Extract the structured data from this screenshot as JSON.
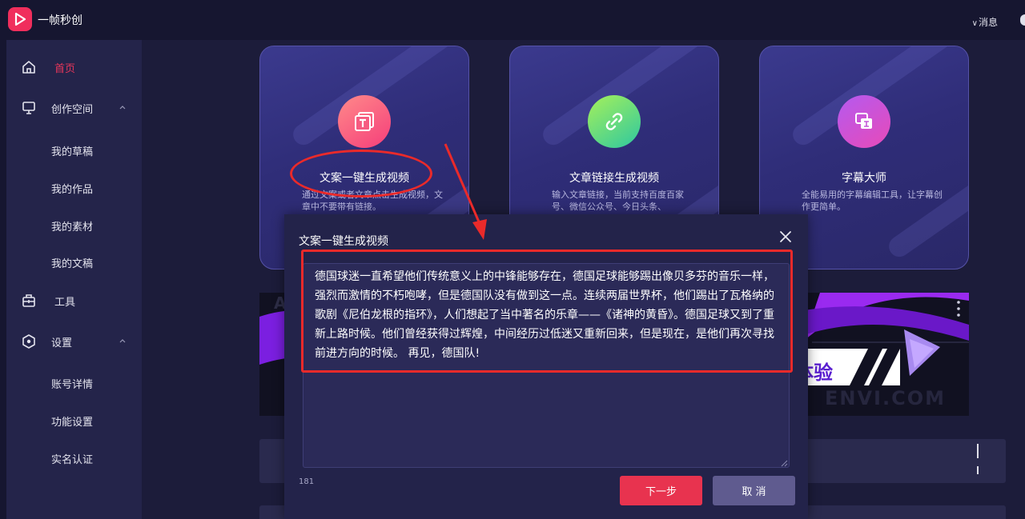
{
  "app": {
    "title": "一帧秒创",
    "messages_label": "消息",
    "brand_color": "#f02e5c"
  },
  "sidebar": {
    "home": "首页",
    "creation_space": "创作空间",
    "creation_items": [
      "我的草稿",
      "我的作品",
      "我的素材",
      "我的文稿"
    ],
    "tools": "工具",
    "settings": "设置",
    "settings_items": [
      "账号详情",
      "功能设置",
      "实名认证"
    ]
  },
  "cards": [
    {
      "title": "文案一键生成视频",
      "desc": "通过文案或者文章点击生成视频，文章中不要带有链接。",
      "icon": "text-t-icon",
      "gradient": [
        "#ff7a8a",
        "#f53e7a"
      ]
    },
    {
      "title": "文章链接生成视频",
      "desc": "输入文章链接，当前支持百度百家号、微信公众号、今日头条、",
      "icon": "link-icon",
      "gradient": [
        "#9af05a",
        "#2ec8a0"
      ]
    },
    {
      "title": "字幕大师",
      "desc": "全能易用的字幕编辑工具，让字幕创作更简单。",
      "icon": "subtitle-icon",
      "gradient": [
        "#c85af0",
        "#e84ab8"
      ]
    }
  ],
  "banner": {
    "text": "体验",
    "watermark": "ENVI.COM"
  },
  "dialog": {
    "title": "文案一键生成视频",
    "text": "德国球迷一直希望他们传统意义上的中锋能够存在，德国足球能够踢出像贝多芬的音乐一样，强烈而激情的不朽咆哮，但是德国队没有做到这一点。连续两届世界杯，他们踢出了瓦格纳的歌剧《尼伯龙根的指环》，人们想起了当中著名的乐章——《诸神的黄昏》。德国足球又到了重新上路时候。他们曾经获得过辉煌，中间经历过低迷又重新回来，但是现在，是他们再次寻找前进方向的时候。 再见，德国队!",
    "char_count": "181",
    "next_label": "下一步",
    "cancel_label": "取 消"
  },
  "annotation_color": "#ea2a2a"
}
